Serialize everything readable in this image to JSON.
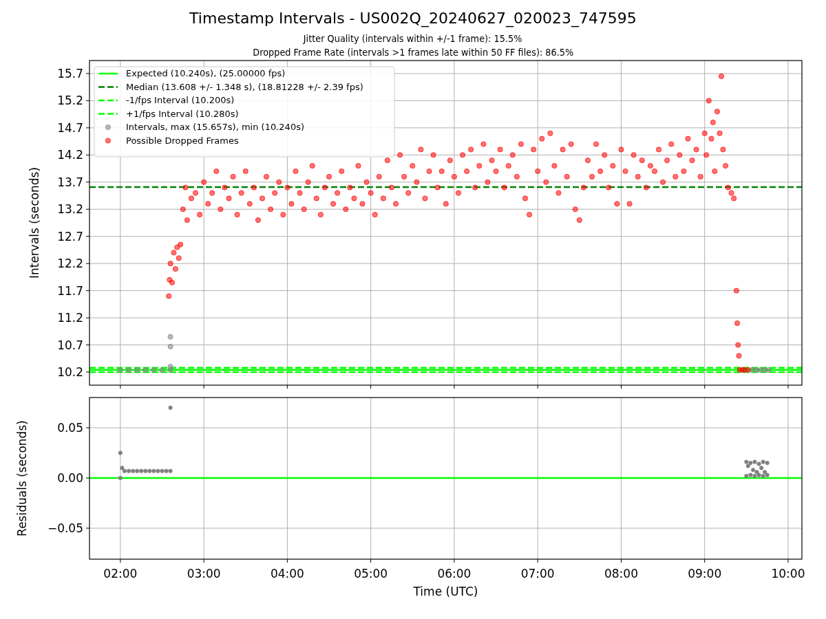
{
  "title": "Timestamp Intervals - US002Q_20240627_020023_747595",
  "subtitles": [
    "Jitter Quality (intervals within +/-1 frame): 15.5%",
    "Dropped Frame Rate (intervals >1 frames late within 50 FF files): 86.5%"
  ],
  "panels": [
    {
      "chart_data": {
        "type": "scatter",
        "ylabel": "Intervals (seconds)",
        "xlim": [
          1.63,
          10.165
        ],
        "ylim": [
          9.959,
          15.94
        ],
        "grid": true,
        "legend": "upper left",
        "ref_lines": [
          {
            "axis": "y",
            "value": 10.24,
            "label": "Expected (10.240s), (25.00000 fps)",
            "color": "#00ff00"
          },
          {
            "axis": "y",
            "value": 13.608,
            "label": "Median (13.608 +/- 1.348 s), (18.81228 +/- 2.39 fps)",
            "color": "#008000"
          },
          {
            "axis": "y",
            "value": 10.2,
            "label": "-1/fps Interval (10.200s)",
            "color": "#00ff00"
          },
          {
            "axis": "y",
            "value": 10.28,
            "label": "+1/fps Interval (10.280s)",
            "color": "#00ff00"
          }
        ],
        "yticks": [
          {
            "value": 10.2,
            "label": "10.2"
          },
          {
            "value": 10.7,
            "label": "10.7"
          },
          {
            "value": 11.2,
            "label": "11.2"
          },
          {
            "value": 11.7,
            "label": "11.7"
          },
          {
            "value": 12.2,
            "label": "12.2"
          },
          {
            "value": 12.7,
            "label": "12.7"
          },
          {
            "value": 13.2,
            "label": "13.2"
          },
          {
            "value": 13.7,
            "label": "13.7"
          },
          {
            "value": 14.2,
            "label": "14.2"
          },
          {
            "value": 14.7,
            "label": "14.7"
          },
          {
            "value": 15.2,
            "label": "15.2"
          },
          {
            "value": 15.7,
            "label": "15.7"
          }
        ],
        "series": [
          {
            "name": "Intervals, max (15.657s), min (10.240s)",
            "color": "#808080",
            "x": [
              2.0,
              2.1,
              2.2,
              2.3,
              2.4,
              2.5,
              2.6,
              2.6,
              2.6,
              2.6,
              9.57,
              9.62,
              9.67,
              9.72,
              9.77
            ],
            "values": [
              10.24,
              10.24,
              10.24,
              10.24,
              10.24,
              10.24,
              10.24,
              10.3,
              10.67,
              10.85,
              10.24,
              10.24,
              10.24,
              10.24,
              10.24
            ]
          },
          {
            "name": "Possible Dropped Frames",
            "color": "#ff0000",
            "x": [
              2.58,
              2.59,
              2.6,
              2.62,
              2.64,
              2.66,
              2.68,
              2.7,
              2.72,
              2.75,
              2.78,
              2.8,
              2.85,
              2.9,
              2.95,
              3.0,
              3.05,
              3.1,
              3.15,
              3.2,
              3.25,
              3.3,
              3.35,
              3.4,
              3.45,
              3.5,
              3.55,
              3.6,
              3.65,
              3.7,
              3.75,
              3.8,
              3.85,
              3.9,
              3.95,
              4.0,
              4.05,
              4.1,
              4.15,
              4.2,
              4.25,
              4.3,
              4.35,
              4.4,
              4.45,
              4.5,
              4.55,
              4.6,
              4.65,
              4.7,
              4.75,
              4.8,
              4.85,
              4.9,
              4.95,
              5.0,
              5.05,
              5.1,
              5.15,
              5.2,
              5.25,
              5.3,
              5.35,
              5.4,
              5.45,
              5.5,
              5.55,
              5.6,
              5.65,
              5.7,
              5.75,
              5.8,
              5.85,
              5.9,
              5.95,
              6.0,
              6.05,
              6.1,
              6.15,
              6.2,
              6.25,
              6.3,
              6.35,
              6.4,
              6.45,
              6.5,
              6.55,
              6.6,
              6.65,
              6.7,
              6.75,
              6.8,
              6.85,
              6.9,
              6.95,
              7.0,
              7.05,
              7.1,
              7.15,
              7.2,
              7.25,
              7.3,
              7.35,
              7.4,
              7.45,
              7.5,
              7.55,
              7.6,
              7.65,
              7.7,
              7.75,
              7.8,
              7.85,
              7.9,
              7.95,
              8.0,
              8.05,
              8.1,
              8.15,
              8.2,
              8.25,
              8.3,
              8.35,
              8.4,
              8.45,
              8.5,
              8.55,
              8.6,
              8.65,
              8.7,
              8.75,
              8.8,
              8.85,
              8.9,
              8.95,
              9.0,
              9.02,
              9.05,
              9.08,
              9.1,
              9.12,
              9.15,
              9.18,
              9.2,
              9.22,
              9.25,
              9.28,
              9.32,
              9.35,
              9.38,
              9.39,
              9.4,
              9.41,
              9.42,
              9.45,
              9.48,
              9.52
            ],
            "values": [
              11.6,
              11.9,
              12.2,
              11.85,
              12.4,
              12.1,
              12.5,
              12.3,
              12.55,
              13.2,
              13.6,
              13.0,
              13.4,
              13.5,
              13.1,
              13.7,
              13.3,
              13.5,
              13.9,
              13.2,
              13.6,
              13.4,
              13.8,
              13.1,
              13.5,
              13.9,
              13.3,
              13.6,
              13.0,
              13.4,
              13.8,
              13.2,
              13.5,
              13.7,
              13.1,
              13.6,
              13.3,
              13.9,
              13.5,
              13.2,
              13.7,
              14.0,
              13.4,
              13.1,
              13.6,
              13.8,
              13.3,
              13.5,
              13.9,
              13.2,
              13.6,
              13.4,
              14.0,
              13.3,
              13.7,
              13.5,
              13.1,
              13.8,
              13.4,
              14.1,
              13.6,
              13.3,
              14.2,
              13.8,
              13.5,
              14.0,
              13.7,
              14.3,
              13.4,
              13.9,
              14.2,
              13.6,
              13.9,
              13.3,
              14.1,
              13.8,
              13.5,
              14.2,
              13.9,
              14.3,
              13.6,
              14.0,
              14.4,
              13.7,
              14.1,
              13.9,
              14.3,
              13.6,
              14.0,
              14.2,
              13.8,
              14.4,
              13.4,
              13.1,
              14.3,
              13.9,
              14.5,
              13.7,
              14.6,
              14.0,
              13.5,
              14.3,
              13.8,
              14.4,
              13.2,
              13.0,
              13.6,
              14.1,
              13.8,
              14.4,
              13.9,
              14.2,
              13.6,
              14.0,
              13.3,
              14.3,
              13.9,
              13.3,
              14.2,
              13.8,
              14.1,
              13.6,
              14.0,
              13.9,
              14.3,
              13.7,
              14.1,
              14.4,
              13.8,
              14.2,
              13.9,
              14.5,
              14.1,
              14.3,
              13.8,
              14.6,
              14.2,
              15.2,
              14.5,
              14.8,
              13.9,
              15.0,
              14.6,
              15.65,
              14.3,
              14.0,
              13.6,
              13.5,
              13.4,
              11.7,
              11.1,
              10.7,
              10.5,
              10.24,
              10.24,
              10.24,
              10.24
            ]
          }
        ]
      }
    },
    {
      "chart_data": {
        "type": "scatter",
        "xlabel": "Time (UTC)",
        "ylabel": "Residuals (seconds)",
        "xlim": [
          1.63,
          10.165
        ],
        "ylim": [
          -0.0808,
          0.0801
        ],
        "grid": true,
        "ref_lines": [
          {
            "axis": "y",
            "value": 0,
            "color": "#00ff00"
          }
        ],
        "xticks": [
          {
            "value": 2,
            "label": "02:00"
          },
          {
            "value": 3,
            "label": "03:00"
          },
          {
            "value": 4,
            "label": "04:00"
          },
          {
            "value": 5,
            "label": "05:00"
          },
          {
            "value": 6,
            "label": "06:00"
          },
          {
            "value": 7,
            "label": "07:00"
          },
          {
            "value": 8,
            "label": "08:00"
          },
          {
            "value": 9,
            "label": "09:00"
          },
          {
            "value": 10,
            "label": "10:00"
          }
        ],
        "yticks": [
          {
            "value": -0.05,
            "label": "−0.05"
          },
          {
            "value": 0,
            "label": "0.00"
          },
          {
            "value": 0.05,
            "label": "0.05"
          }
        ],
        "series": [
          {
            "color": "#808080",
            "x": [
              2.0,
              2.0,
              2.02,
              2.05,
              2.1,
              2.15,
              2.2,
              2.25,
              2.3,
              2.35,
              2.4,
              2.45,
              2.5,
              2.55,
              2.6,
              2.6,
              9.5,
              9.52,
              9.55,
              9.58,
              9.6,
              9.625,
              9.65,
              9.68,
              9.7,
              9.72,
              9.75,
              9.5,
              9.55,
              9.6,
              9.65,
              9.7,
              9.75
            ],
            "values": [
              0.0,
              0.025,
              0.01,
              0.007,
              0.007,
              0.007,
              0.007,
              0.007,
              0.007,
              0.007,
              0.007,
              0.007,
              0.007,
              0.007,
              0.007,
              0.07,
              0.016,
              0.012,
              0.015,
              0.008,
              0.016,
              0.006,
              0.014,
              0.01,
              0.016,
              0.006,
              0.015,
              0.002,
              0.003,
              0.002,
              0.003,
              0.002,
              0.003
            ]
          }
        ]
      }
    }
  ]
}
